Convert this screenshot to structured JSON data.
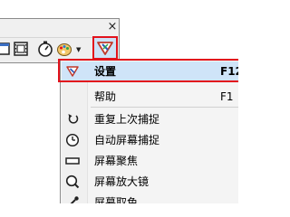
{
  "window": {
    "close_glyph": "×"
  },
  "toolbar": {
    "buttons": [
      {
        "icon": "capture-region-icon"
      },
      {
        "icon": "film-strip-icon"
      },
      {
        "icon": "timer-icon"
      },
      {
        "icon": "palette-icon"
      },
      {
        "icon": "settings-pen-icon"
      }
    ]
  },
  "menu": {
    "items": [
      {
        "label": "设置",
        "shortcut": "F12",
        "icon": "settings-pen-icon",
        "highlighted": true
      },
      {
        "label": "帮助",
        "shortcut": "F1",
        "icon": ""
      },
      {
        "label": "重复上次捕捉",
        "shortcut": "",
        "icon": "repeat-arrow-icon"
      },
      {
        "label": "自动屏幕捕捉",
        "shortcut": "",
        "icon": "clock-icon"
      },
      {
        "label": "屏幕聚焦",
        "shortcut": "",
        "icon": "focus-rectangle-icon"
      },
      {
        "label": "屏幕放大镜",
        "shortcut": "",
        "icon": "magnifier-icon"
      },
      {
        "label": "屏幕取色",
        "shortcut": "",
        "icon": "eyedropper-icon"
      }
    ]
  },
  "colors": {
    "highlight_border": "#e2121c",
    "highlight_fill": "#cfe4f8"
  }
}
